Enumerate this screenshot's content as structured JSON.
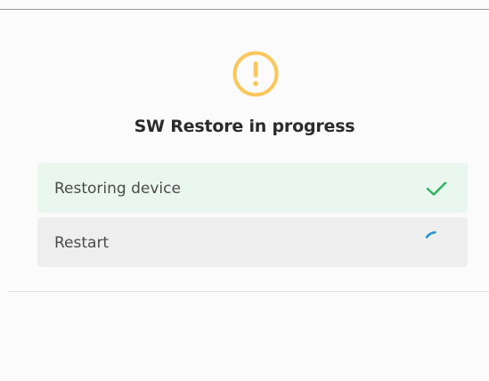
{
  "dialog": {
    "title": "SW Restore in progress",
    "status_icon": "warning-circle-icon",
    "accent_color": "#fbc65a"
  },
  "steps": [
    {
      "label": "Restoring device",
      "state": "completed",
      "icon": "check-icon",
      "color": "#2db35d"
    },
    {
      "label": "Restart",
      "state": "in-progress",
      "icon": "spinner-icon",
      "color": "#1f92c9"
    }
  ]
}
